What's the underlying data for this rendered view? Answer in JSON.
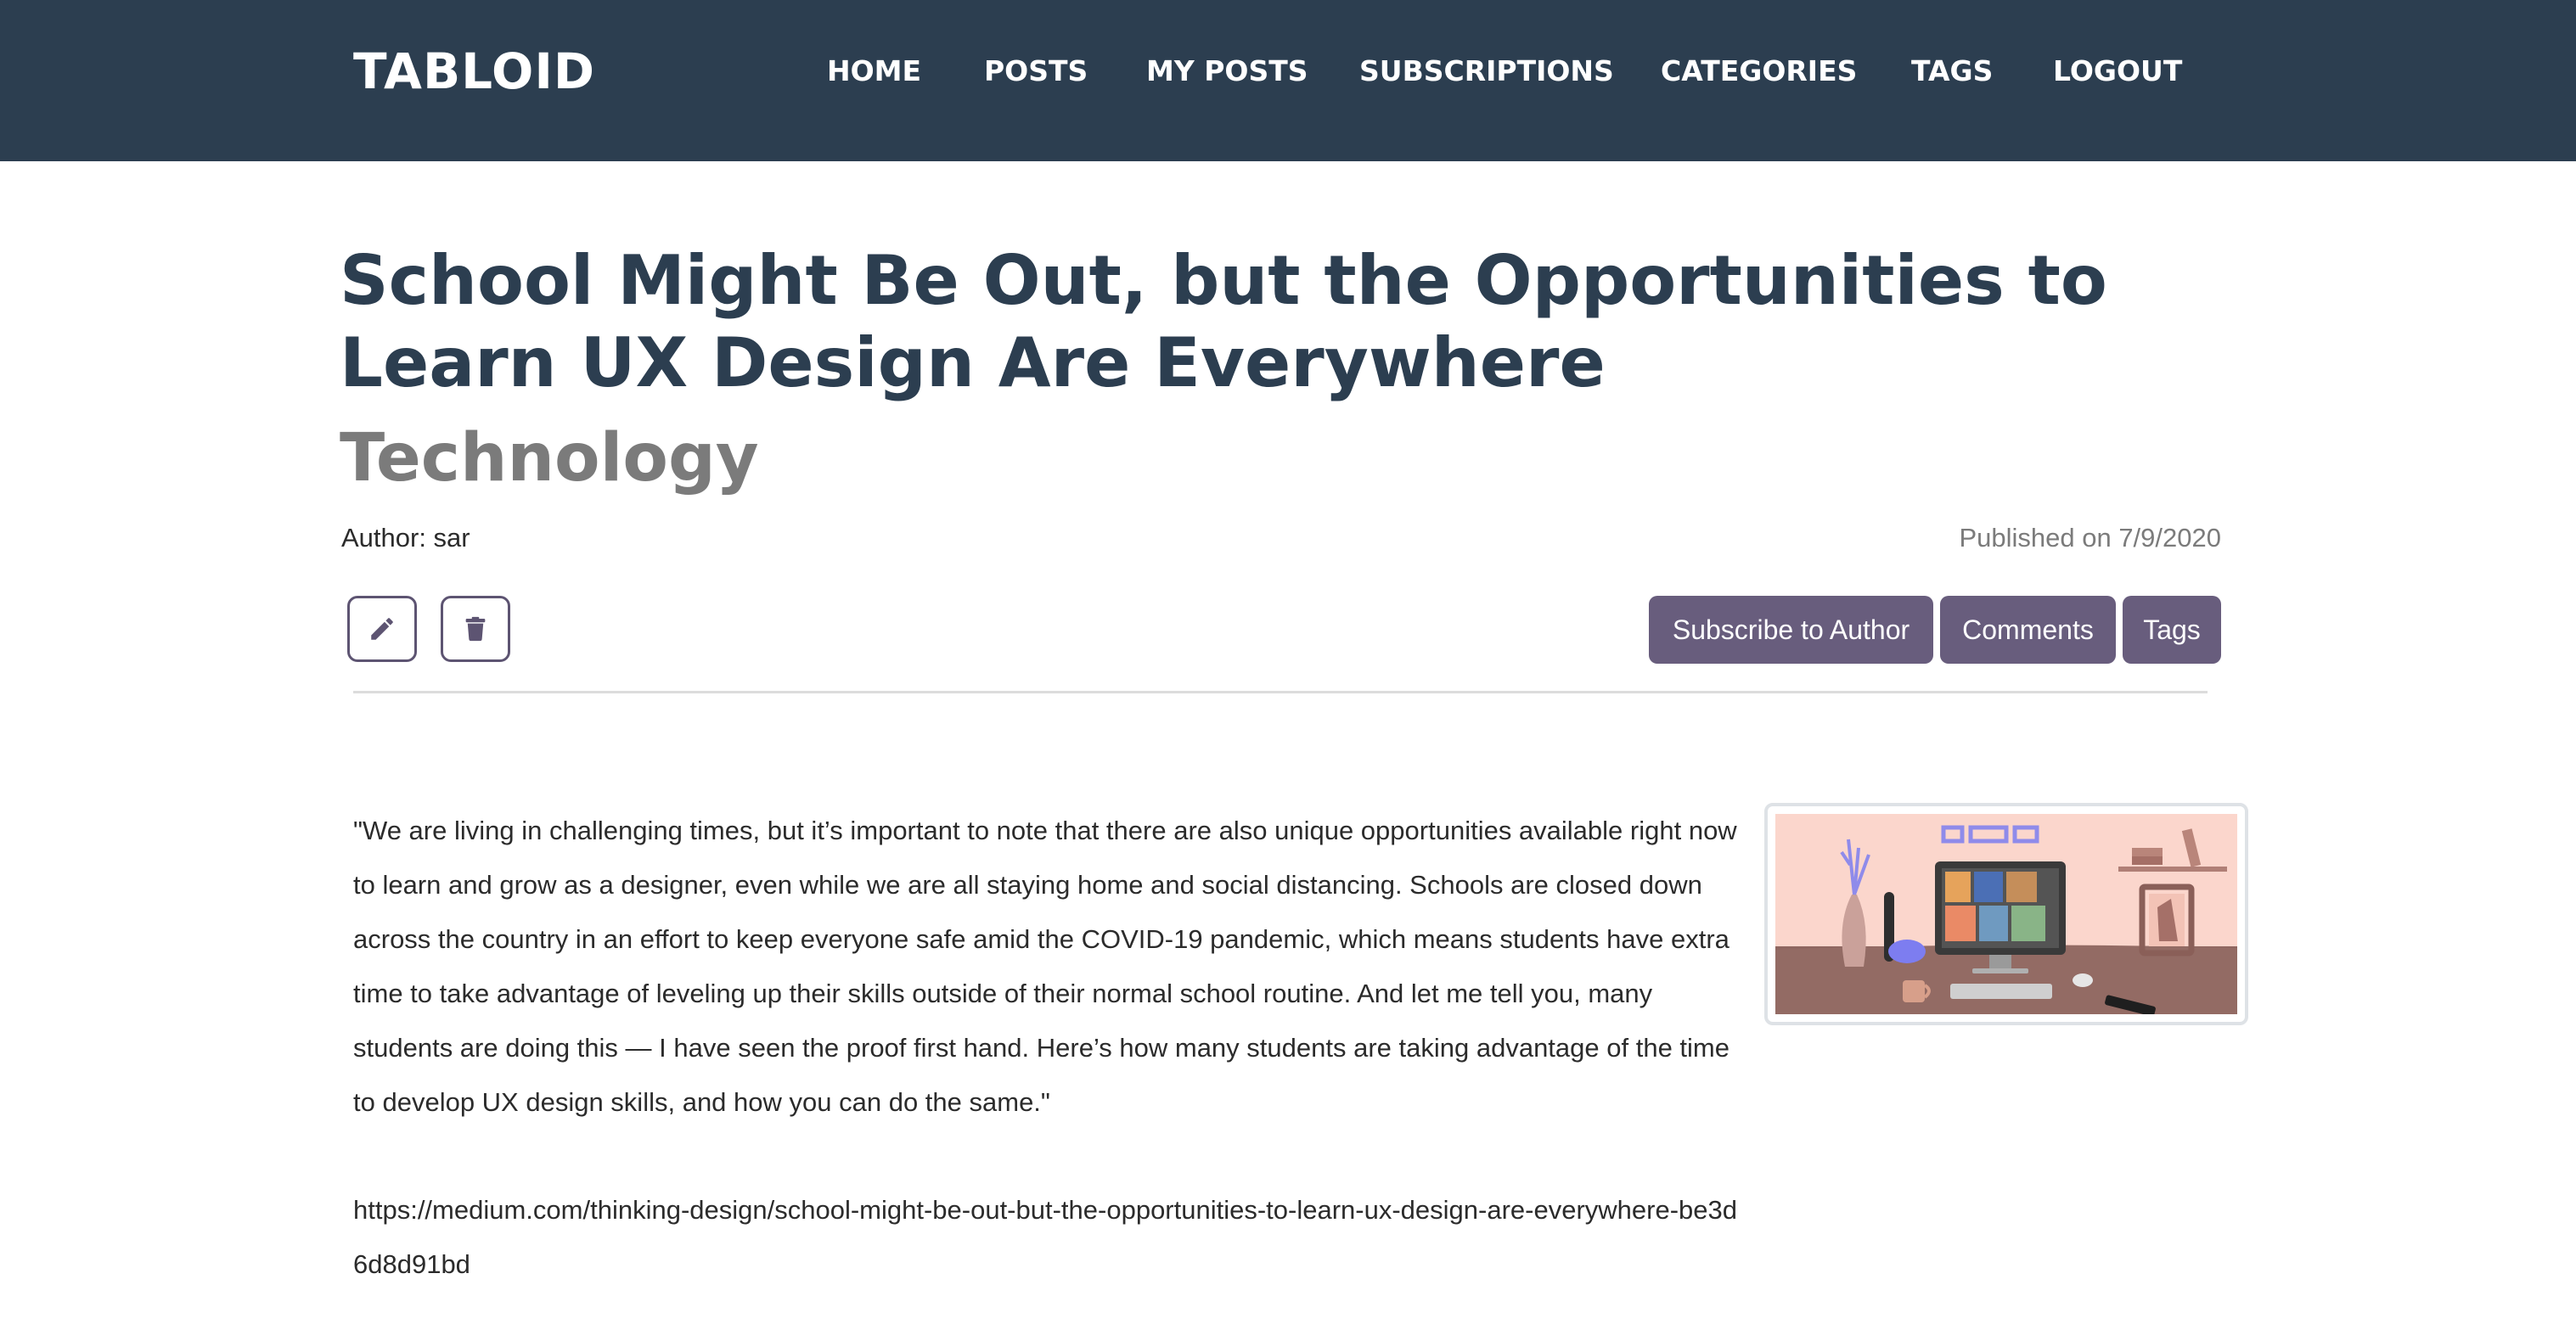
{
  "brand": "TABLOID",
  "nav": [
    {
      "label": "HOME"
    },
    {
      "label": "POSTS"
    },
    {
      "label": "MY POSTS"
    },
    {
      "label": "SUBSCRIPTIONS"
    },
    {
      "label": "CATEGORIES"
    },
    {
      "label": "TAGS"
    },
    {
      "label": "LOGOUT"
    }
  ],
  "post": {
    "title": "School Might Be Out, but the Opportunities to Learn UX Design Are Everywhere",
    "category": "Technology",
    "author": "Author: sar",
    "published": "Published on 7/9/2020",
    "body": "\"We are living in challenging times, but it’s important to note that there are also unique opportunities available right now to learn and grow as a designer, even while we are all staying home and social distancing. Schools are closed down across the country in an effort to keep everyone safe amid the COVID-19 pandemic, which means students have extra time to take advantage of leveling up their skills outside of their normal school routine. And let me tell you, many students are doing this — I have seen the proof first hand. Here’s how many students are taking advantage of the time to develop UX design skills, and how you can do the same.\"",
    "link": "https://medium.com/thinking-design/school-might-be-out-but-the-opportunities-to-learn-ux-design-are-everywhere-be3d6d8d91bd"
  },
  "actions": {
    "edit_icon": "pencil-icon",
    "delete_icon": "trash-icon",
    "subscribe": "Subscribe to Author",
    "comments": "Comments",
    "tags": "Tags"
  },
  "colors": {
    "navbar": "#2c3e50",
    "title": "#2c3e50",
    "category": "#7b7b7b",
    "button": "#685d7d",
    "icon_border": "#5d5472"
  }
}
